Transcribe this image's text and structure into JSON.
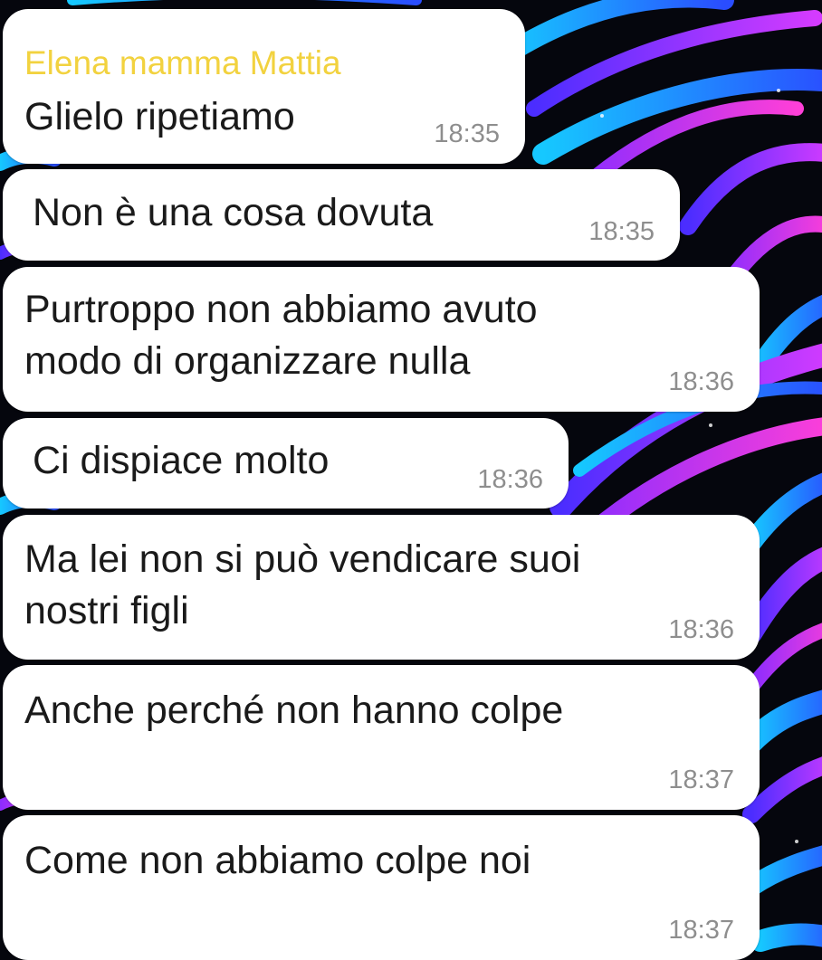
{
  "chat": {
    "messages": [
      {
        "sender": "Elena mamma Mattia",
        "text": "Glielo ripetiamo",
        "time": "18:35"
      },
      {
        "text": "Non è una cosa dovuta",
        "time": "18:35"
      },
      {
        "text_lines": [
          "Purtroppo non abbiamo avuto",
          "modo di organizzare nulla"
        ],
        "time": "18:36"
      },
      {
        "text": "Ci dispiace molto",
        "time": "18:36"
      },
      {
        "text_lines": [
          "Ma lei non si può vendicare suoi",
          "nostri figli"
        ],
        "time": "18:36"
      },
      {
        "text": "Anche perché non hanno colpe",
        "time": "18:37"
      },
      {
        "text": "Come non abbiamo colpe noi",
        "time": "18:37"
      }
    ]
  },
  "theme": {
    "bubble_bg": "#ffffff",
    "sender_color": "#f2d23f",
    "text_color": "#1a1a1a",
    "time_color": "#8e8e8e",
    "wallpaper_colors": [
      "#05060d",
      "#1f8bff",
      "#7a2cff",
      "#d43bff",
      "#19d3ff"
    ]
  }
}
